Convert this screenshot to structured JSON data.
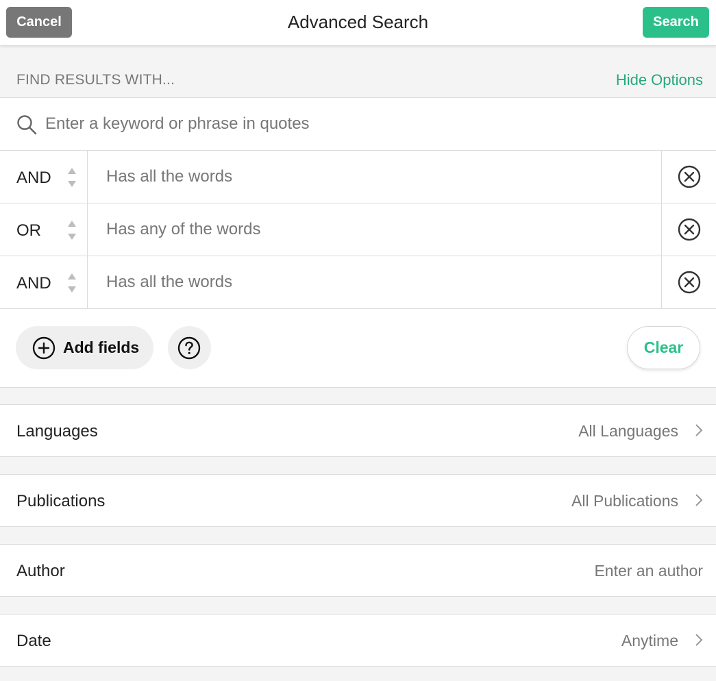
{
  "header": {
    "cancel_label": "Cancel",
    "title": "Advanced Search",
    "search_label": "Search"
  },
  "find_bar": {
    "label": "FIND RESULTS WITH...",
    "hide_options_label": "Hide Options"
  },
  "keyword": {
    "placeholder": "Enter a keyword or phrase in quotes",
    "value": ""
  },
  "terms": [
    {
      "operator": "AND",
      "placeholder": "Has all the words",
      "value": ""
    },
    {
      "operator": "OR",
      "placeholder": "Has any of the words",
      "value": ""
    },
    {
      "operator": "AND",
      "placeholder": "Has all the words",
      "value": ""
    }
  ],
  "actions": {
    "add_fields_label": "Add fields",
    "clear_label": "Clear"
  },
  "filters": {
    "languages": {
      "label": "Languages",
      "value": "All Languages"
    },
    "publications": {
      "label": "Publications",
      "value": "All Publications"
    },
    "author": {
      "label": "Author",
      "placeholder": "Enter an author",
      "value": ""
    },
    "date": {
      "label": "Date",
      "value": "Anytime"
    }
  },
  "icons": {
    "search": "search-icon",
    "sort": "sort-arrows-icon",
    "remove": "close-circle-icon",
    "add": "plus-circle-icon",
    "help": "question-circle-icon",
    "chevron": "chevron-right-icon"
  },
  "colors": {
    "accent": "#2bc08a",
    "accent_text": "#26a87a",
    "cancel_bg": "#777777",
    "muted_text": "#777777",
    "page_bg": "#f4f4f4",
    "divider": "#dcdcdc"
  }
}
